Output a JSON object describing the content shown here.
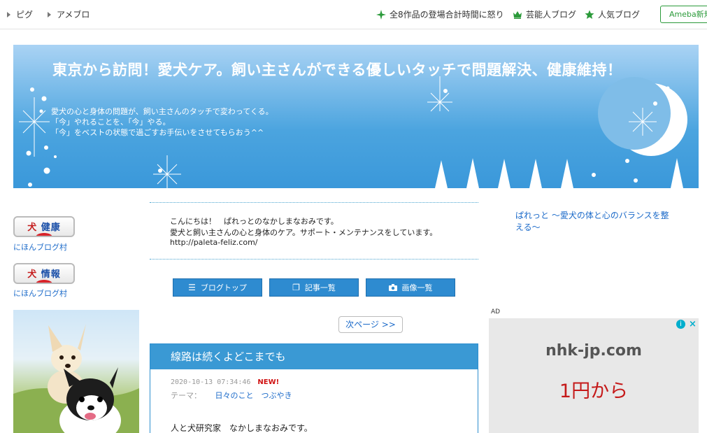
{
  "topbar": {
    "left_links": [
      {
        "label": "ピグ"
      },
      {
        "label": "アメブロ"
      }
    ],
    "right_links": [
      {
        "label": "全8作品の登場合計時間に怒り",
        "icon": "green-sparkle-icon"
      },
      {
        "label": "芸能人ブログ",
        "icon": "crown-icon"
      },
      {
        "label": "人気ブログ",
        "icon": "green-star-icon"
      }
    ],
    "ameba_button": "Ameba新規"
  },
  "banner": {
    "title": "東京から訪問！愛犬ケア。飼い主さんができる優しいタッチで問題解決、健康維持！",
    "desc": [
      "愛犬の心と身体の問題が、飼い主さんのタッチで変わってくる。",
      "「今」やれることを、「今」やる。",
      "「今」をベストの状態で過ごすお手伝いをさせてもらおう^^"
    ]
  },
  "sidebar_left": {
    "badges": [
      {
        "char1": "犬",
        "char2": "健康",
        "caption": "にほんブログ村"
      },
      {
        "char1": "犬",
        "char2": "情報",
        "caption": "にほんブログ村"
      }
    ]
  },
  "intro": {
    "lines": [
      "こんにちは！　ぱれっとのなかしまなおみです。",
      "愛犬と飼い主さんの心と身体のケア。サポート・メンテナンスをしています。",
      "http://paleta-feliz.com/"
    ]
  },
  "nav": {
    "buttons": [
      {
        "label": "ブログトップ",
        "icon": "list-icon"
      },
      {
        "label": "記事一覧",
        "icon": "copy-icon"
      },
      {
        "label": "画像一覧",
        "icon": "camera-icon"
      }
    ],
    "next_page": "次ページ >>"
  },
  "article": {
    "title": "線路は続くよどこまでも",
    "datetime": "2020-10-13 07:34:46",
    "new_label": "NEW!",
    "theme_label": "テーマ：",
    "theme_value": "日々のこと　つぶやき",
    "body_first_line": "人と犬研究家　なかしまなおみです。"
  },
  "sidebar_right": {
    "blog_title": "ぱれっと ～愛犬の体と心のバランスを整える～"
  },
  "ad": {
    "label": "AD",
    "domain": "nhk-jp.com",
    "price": "1円から",
    "info_icon": "i",
    "close_icon": "×",
    "accent": "#00aecd"
  },
  "colors": {
    "link": "#1b6ac9",
    "button_blue": "#2e8bd0",
    "article_header": "#3a99d4"
  }
}
